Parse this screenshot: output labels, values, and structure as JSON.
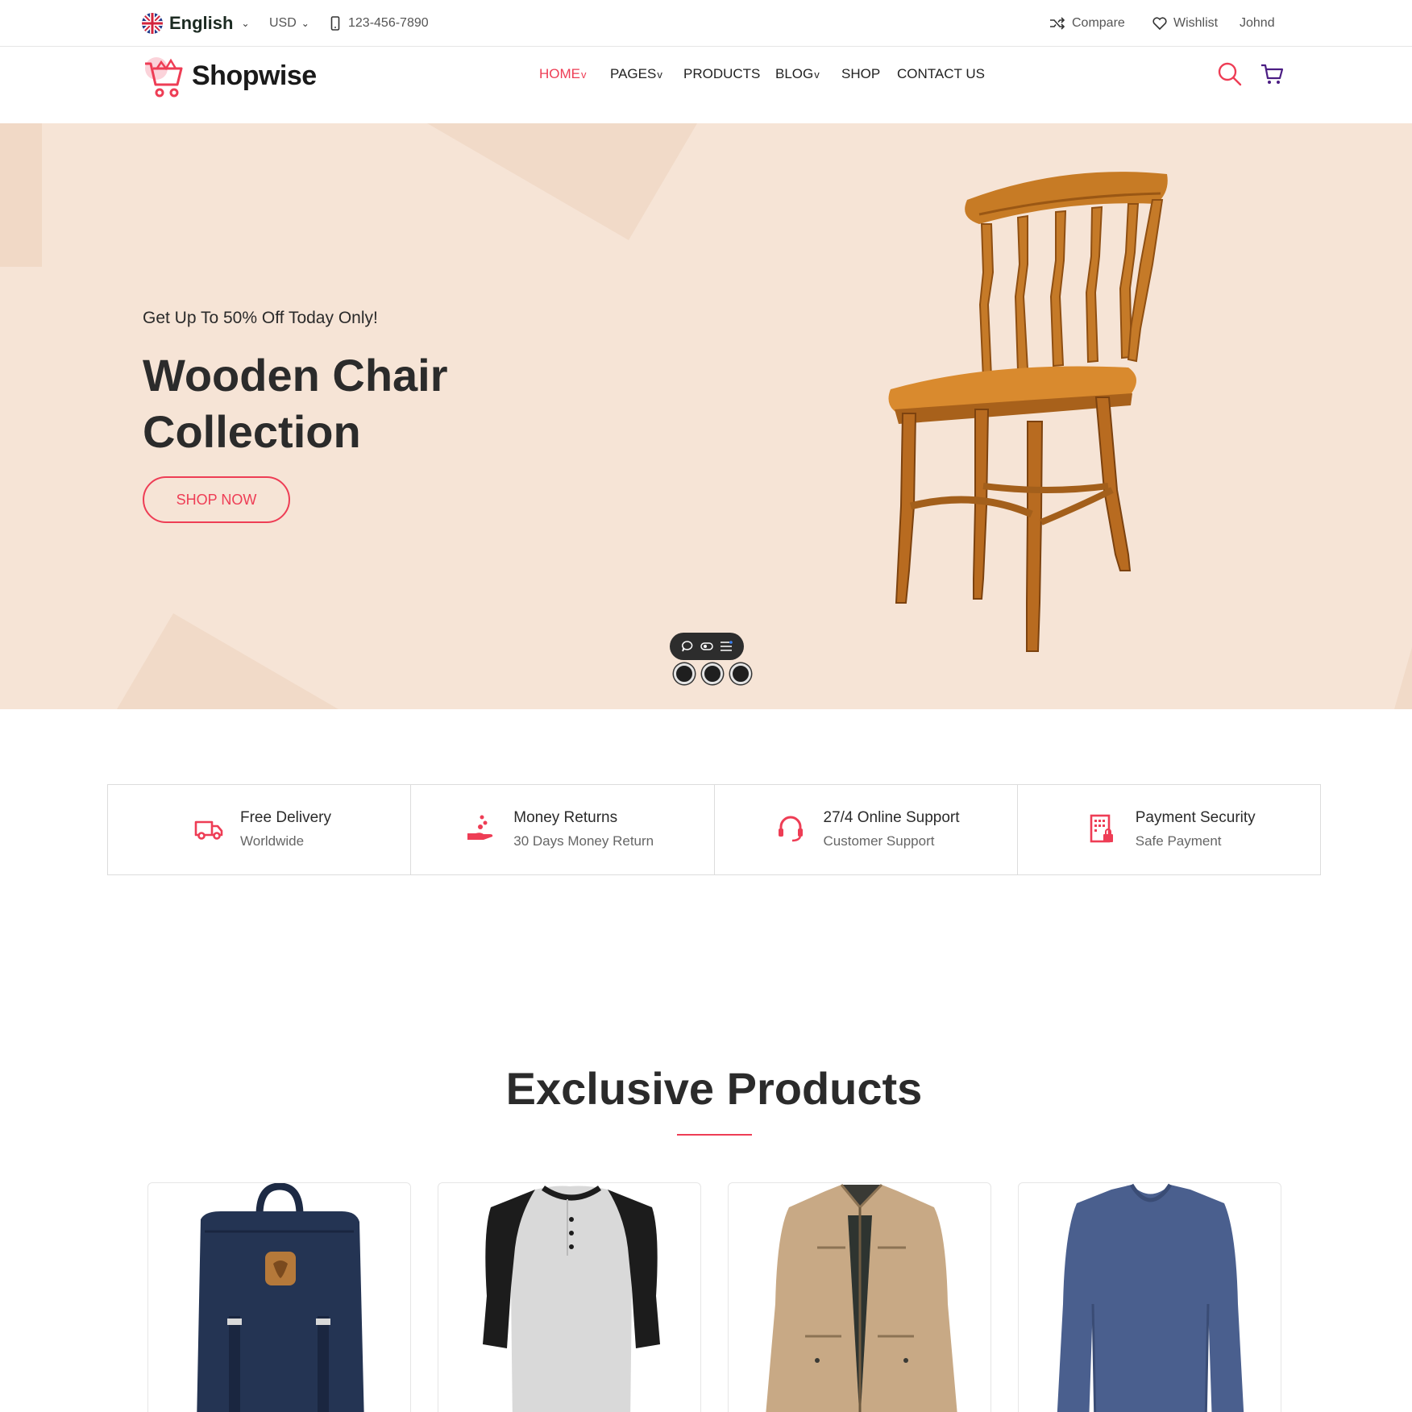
{
  "topbar": {
    "language": "English",
    "currency": "USD",
    "phone": "123-456-7890",
    "compare": "Compare",
    "wishlist": "Wishlist",
    "user": "Johnd"
  },
  "header": {
    "brand": "Shopwise",
    "nav": [
      {
        "label": "HOME",
        "has_dropdown": true,
        "active": true
      },
      {
        "label": "PAGES",
        "has_dropdown": true,
        "active": false
      },
      {
        "label": "PRODUCTS",
        "has_dropdown": false,
        "active": false
      },
      {
        "label": "BLOG",
        "has_dropdown": true,
        "active": false
      },
      {
        "label": "SHOP",
        "has_dropdown": false,
        "active": false
      },
      {
        "label": "CONTACT US",
        "has_dropdown": false,
        "active": false
      }
    ]
  },
  "hero": {
    "subtitle": "Get Up To 50% Off Today Only!",
    "title": "Wooden Chair Collection",
    "button": "SHOP NOW",
    "slide_count": 3
  },
  "services": [
    {
      "icon": "delivery-truck-icon",
      "title": "Free Delivery",
      "subtitle": "Worldwide"
    },
    {
      "icon": "money-hand-icon",
      "title": "Money Returns",
      "subtitle": "30 Days Money Return"
    },
    {
      "icon": "headset-icon",
      "title": "27/4 Online Support",
      "subtitle": "Customer Support"
    },
    {
      "icon": "secure-building-icon",
      "title": "Payment Security",
      "subtitle": "Safe Payment"
    }
  ],
  "products": {
    "title": "Exclusive Products",
    "items": [
      {
        "icon": "backpack-icon"
      },
      {
        "icon": "raglan-shirt-icon"
      },
      {
        "icon": "jacket-icon"
      },
      {
        "icon": "sweater-icon"
      }
    ]
  },
  "colors": {
    "accent": "#ee3d55",
    "hero_bg": "#f6e4d6",
    "text": "#2b2b2b"
  }
}
